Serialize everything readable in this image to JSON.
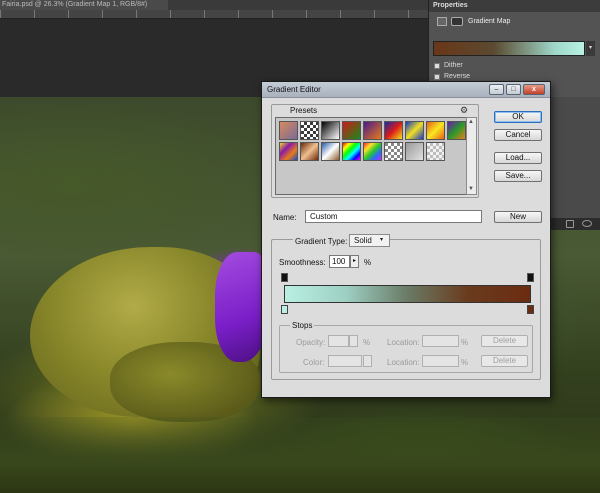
{
  "document": {
    "tab_title": "Fairia.psd @ 26.3% (Gradient Map 1, RGB/8#)"
  },
  "properties": {
    "tab_label": "Properties",
    "panel_title": "Gradient Map",
    "dither_label": "Dither",
    "reverse_label": "Reverse",
    "dropdown_arrow": "▾"
  },
  "gradient_editor": {
    "title": "Gradient Editor",
    "window_buttons": {
      "minimize": "–",
      "maximize": "□",
      "close": "x"
    },
    "presets_label": "Presets",
    "presets_menu_icon": "gear-icon",
    "presets": [
      {
        "name": "foreground-to-background",
        "colors": [
          "#d88a5a",
          "#7a6a9a"
        ]
      },
      {
        "name": "foreground-to-transparent",
        "colors": [
          "#3a3a3a",
          "#ffffff"
        ]
      },
      {
        "name": "black-white",
        "colors": [
          "#000000",
          "#ffffff"
        ]
      },
      {
        "name": "red-green",
        "colors": [
          "#cc1a1a",
          "#1a8a1a"
        ]
      },
      {
        "name": "violet-orange",
        "colors": [
          "#4a1a8a",
          "#e87a1a"
        ]
      },
      {
        "name": "blue-red-yellow",
        "colors": [
          "#1a2aa8",
          "#d81a1a",
          "#f8e01a"
        ]
      },
      {
        "name": "blue-yellow-blue",
        "colors": [
          "#1a3ac8",
          "#f0e020",
          "#1a3ac8"
        ]
      },
      {
        "name": "orange-yellow-orange",
        "colors": [
          "#e8601a",
          "#f8e820",
          "#e8601a"
        ]
      },
      {
        "name": "violet-green-orange",
        "colors": [
          "#6a1aa8",
          "#2a9a2a",
          "#e8801a"
        ]
      },
      {
        "name": "yellow-violet-orange-blue",
        "colors": [
          "#f0d820",
          "#8a1aa8",
          "#e87a1a",
          "#1a4ac8"
        ]
      },
      {
        "name": "copper",
        "colors": [
          "#6a2a0a",
          "#f0c090",
          "#6a2a0a"
        ]
      },
      {
        "name": "chrome",
        "colors": [
          "#2a5aa8",
          "#ffffff",
          "#8a5a2a"
        ]
      },
      {
        "name": "spectrum",
        "colors": [
          "#ff0000",
          "#ffff00",
          "#00ff00",
          "#00ffff",
          "#0000ff",
          "#ff00ff"
        ]
      },
      {
        "name": "transparent-rainbow",
        "colors": [
          "#ff2a2a",
          "#ffe02a",
          "#2ac82a",
          "#2a6aff",
          "#c82aff"
        ]
      },
      {
        "name": "transparent-stripes",
        "colors": [
          "#ffffff",
          "#888888"
        ]
      },
      {
        "name": "neutral-density",
        "colors": [
          "#9a9a9a",
          "#e0e0e0"
        ]
      },
      {
        "name": "transparent-checker",
        "colors": [
          "#bdbdbd",
          "#f2f2f2"
        ]
      }
    ],
    "buttons": {
      "ok": "OK",
      "cancel": "Cancel",
      "load": "Load...",
      "save": "Save...",
      "new": "New"
    },
    "name_label": "Name:",
    "name_value": "Custom",
    "gradient_type_label": "Gradient Type:",
    "gradient_type_value": "Solid",
    "select_arrow": "▾",
    "smoothness_label": "Smoothness:",
    "smoothness_value": "100",
    "smoothness_arrow": "▸",
    "percent": "%",
    "gradient_colors": [
      "#b9f0e3",
      "#9dcfc2",
      "#6a7a66",
      "#6a3a1c",
      "#6b2c12"
    ],
    "stops": {
      "label": "Stops",
      "opacity_label": "Opacity:",
      "color_label": "Color:",
      "location_label": "Location:",
      "delete_label": "Delete"
    }
  }
}
